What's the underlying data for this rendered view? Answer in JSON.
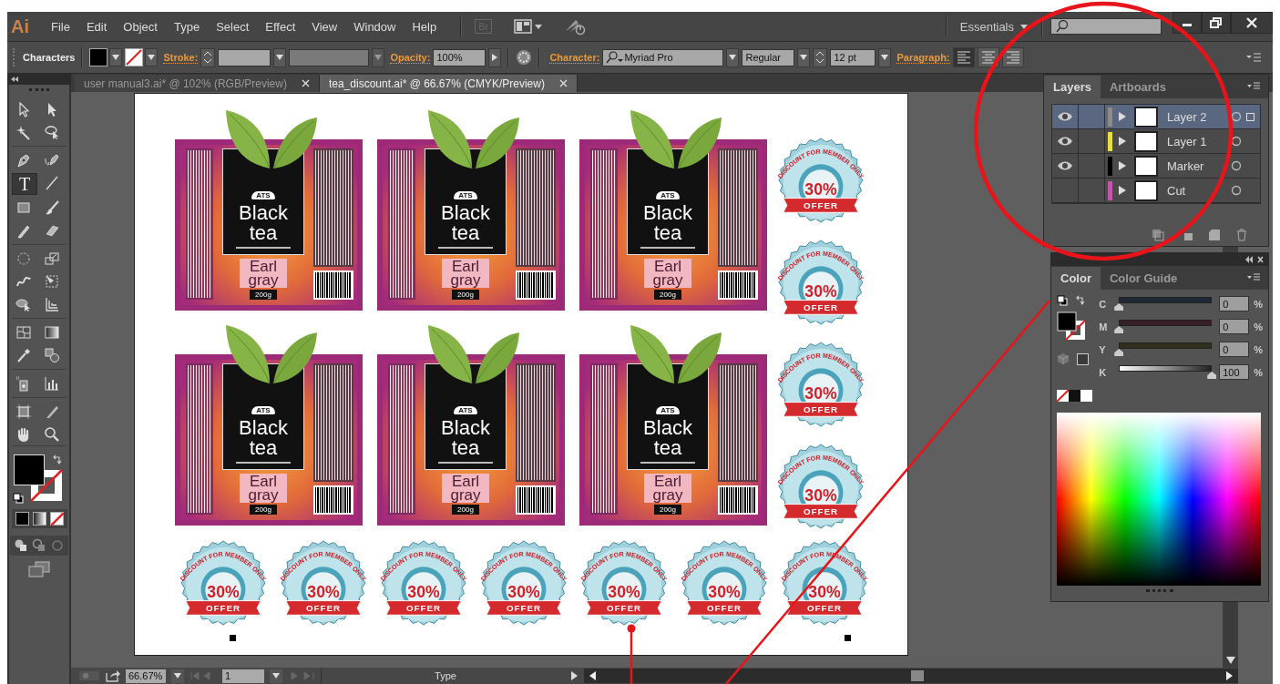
{
  "app_logo": "Ai",
  "menu": [
    "File",
    "Edit",
    "Object",
    "Type",
    "Select",
    "Effect",
    "View",
    "Window",
    "Help"
  ],
  "bridge": "Br",
  "workspace": "Essentials",
  "control_bar": {
    "mode": "Characters",
    "stroke_label": "Stroke:",
    "opacity_label": "Opacity:",
    "opacity": "100%",
    "character_label": "Character:",
    "font": "Myriad Pro",
    "font_style": "Regular",
    "font_size": "12 pt",
    "paragraph_label": "Paragraph:",
    "align_buttons": [
      {
        "kind": "left",
        "selected": true
      },
      {
        "kind": "center",
        "selected": false
      },
      {
        "kind": "right",
        "selected": false
      }
    ]
  },
  "tabs": [
    {
      "label": "user manual3.ai* @ 102% (RGB/Preview)",
      "selected": false
    },
    {
      "label": "tea_discount.ai* @ 66.67% (CMYK/Preview)",
      "selected": true
    }
  ],
  "tools": [
    {
      "kind": "select",
      "selected": false
    },
    {
      "kind": "direct-select",
      "selected": false
    },
    {
      "kind": "wand",
      "selected": false
    },
    {
      "kind": "lasso",
      "selected": false
    },
    {
      "kind": "pen",
      "selected": false
    },
    {
      "kind": "curvature",
      "selected": false
    },
    {
      "kind": "type",
      "glyph": "T",
      "selected": true
    },
    {
      "kind": "line",
      "selected": false
    },
    {
      "kind": "rect",
      "selected": false
    },
    {
      "kind": "brush",
      "selected": false
    },
    {
      "kind": "pencil",
      "selected": false
    },
    {
      "kind": "eraser",
      "selected": false
    },
    {
      "kind": "rotate",
      "selected": false
    },
    {
      "kind": "scale",
      "selected": false
    },
    {
      "kind": "warp",
      "selected": false
    },
    {
      "kind": "free-transform",
      "selected": false
    },
    {
      "kind": "shape-builder",
      "selected": false
    },
    {
      "kind": "perspective",
      "selected": false
    },
    {
      "kind": "mesh",
      "selected": false
    },
    {
      "kind": "gradient",
      "selected": false
    },
    {
      "kind": "eyedropper",
      "selected": false
    },
    {
      "kind": "blend",
      "selected": false
    },
    {
      "kind": "sprayer",
      "selected": false
    },
    {
      "kind": "graph",
      "selected": false
    },
    {
      "kind": "artboard",
      "selected": false
    },
    {
      "kind": "slice",
      "selected": false
    },
    {
      "kind": "hand",
      "selected": false
    },
    {
      "kind": "zoom",
      "selected": false
    }
  ],
  "labels": [
    {
      "brand": "ATS",
      "title": "Black tea",
      "flavor": "Earl gray",
      "weight": "200g"
    },
    {
      "brand": "ATS",
      "title": "Black tea",
      "flavor": "Earl gray",
      "weight": "200g"
    },
    {
      "brand": "ATS",
      "title": "Black tea",
      "flavor": "Earl gray",
      "weight": "200g"
    },
    {
      "brand": "ATS",
      "title": "Black tea",
      "flavor": "Earl gray",
      "weight": "200g"
    },
    {
      "brand": "ATS",
      "title": "Black tea",
      "flavor": "Earl gray",
      "weight": "200g"
    },
    {
      "brand": "ATS",
      "title": "Black tea",
      "flavor": "Earl gray",
      "weight": "200g"
    }
  ],
  "side_badges": [
    {
      "arc": "DISCOUNT FOR MEMBER ONLY",
      "value": "30%",
      "ribbon": "OFFER"
    },
    {
      "arc": "DISCOUNT FOR MEMBER ONLY",
      "value": "30%",
      "ribbon": "OFFER"
    },
    {
      "arc": "DISCOUNT FOR MEMBER ONLY",
      "value": "30%",
      "ribbon": "OFFER"
    },
    {
      "arc": "DISCOUNT FOR MEMBER ONLY",
      "value": "30%",
      "ribbon": "OFFER"
    }
  ],
  "bottom_badges": [
    {
      "arc": "DISCOUNT FOR MEMBER ONLY",
      "value": "30%",
      "ribbon": "OFFER"
    },
    {
      "arc": "DISCOUNT FOR MEMBER ONLY",
      "value": "30%",
      "ribbon": "OFFER"
    },
    {
      "arc": "DISCOUNT FOR MEMBER ONLY",
      "value": "30%",
      "ribbon": "OFFER"
    },
    {
      "arc": "DISCOUNT FOR MEMBER ONLY",
      "value": "30%",
      "ribbon": "OFFER"
    },
    {
      "arc": "DISCOUNT FOR MEMBER ONLY",
      "value": "30%",
      "ribbon": "OFFER"
    },
    {
      "arc": "DISCOUNT FOR MEMBER ONLY",
      "value": "30%",
      "ribbon": "OFFER"
    },
    {
      "arc": "DISCOUNT FOR MEMBER ONLY",
      "value": "30%",
      "ribbon": "OFFER"
    }
  ],
  "layers_panel": {
    "tabs": [
      {
        "label": "Layers",
        "selected": true
      },
      {
        "label": "Artboards",
        "selected": false
      }
    ],
    "layers": [
      {
        "name": "Layer 2",
        "visible": true,
        "color": "#8c8c8c",
        "selected": true
      },
      {
        "name": "Layer 1",
        "visible": true,
        "color": "#e8e040",
        "selected": false
      },
      {
        "name": "Marker",
        "visible": true,
        "color": "#000000",
        "selected": false
      },
      {
        "name": "Cut",
        "visible": false,
        "color": "#c058a8",
        "selected": false
      }
    ]
  },
  "color_panel": {
    "tabs": [
      {
        "label": "Color",
        "selected": true
      },
      {
        "label": "Color Guide",
        "selected": false
      }
    ],
    "sliders": [
      {
        "channel": "C",
        "value": "0",
        "unit": "%",
        "level": 0
      },
      {
        "channel": "M",
        "value": "0",
        "unit": "%",
        "level": 0
      },
      {
        "channel": "Y",
        "value": "0",
        "unit": "%",
        "level": 0
      },
      {
        "channel": "K",
        "value": "100",
        "unit": "%",
        "level": 1
      }
    ]
  },
  "status_bar": {
    "zoom": "66.67%",
    "artboard": "1",
    "tool": "Type"
  }
}
